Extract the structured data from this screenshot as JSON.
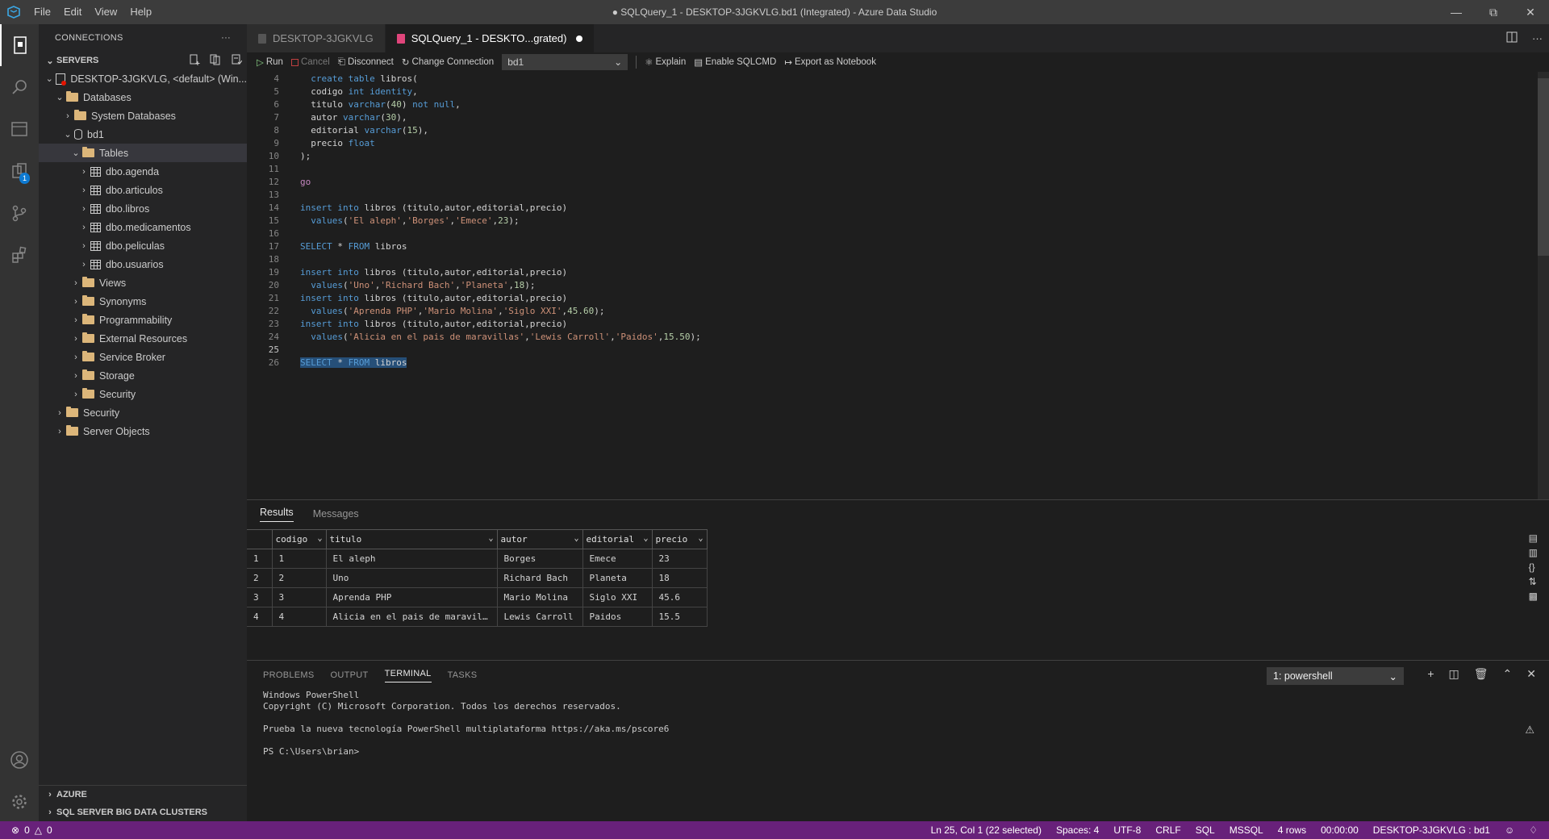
{
  "window": {
    "title": "● SQLQuery_1 - DESKTOP-3JGKVLG.bd1 (Integrated) - Azure Data Studio",
    "menu": [
      "File",
      "Edit",
      "View",
      "Help"
    ]
  },
  "activity": {
    "extensions_badge": "1"
  },
  "sidebar": {
    "header": "CONNECTIONS",
    "header_more": "···",
    "servers_label": "SERVERS",
    "tree": [
      {
        "label": "DESKTOP-3JGKVLG, <default> (Win..."
      },
      {
        "label": "Databases"
      },
      {
        "label": "System Databases"
      },
      {
        "label": "bd1"
      },
      {
        "label": "Tables"
      },
      {
        "label": "dbo.agenda"
      },
      {
        "label": "dbo.articulos"
      },
      {
        "label": "dbo.libros"
      },
      {
        "label": "dbo.medicamentos"
      },
      {
        "label": "dbo.peliculas"
      },
      {
        "label": "dbo.usuarios"
      },
      {
        "label": "Views"
      },
      {
        "label": "Synonyms"
      },
      {
        "label": "Programmability"
      },
      {
        "label": "External Resources"
      },
      {
        "label": "Service Broker"
      },
      {
        "label": "Storage"
      },
      {
        "label": "Security"
      },
      {
        "label": "Security"
      },
      {
        "label": "Server Objects"
      }
    ],
    "azure_label": "AZURE",
    "bigdata_label": "SQL SERVER BIG DATA CLUSTERS"
  },
  "tabs": [
    {
      "label": "DESKTOP-3JGKVLG"
    },
    {
      "label": "SQLQuery_1 - DESKTO...grated)"
    }
  ],
  "toolbar": {
    "run": "Run",
    "cancel": "Cancel",
    "disconnect": "Disconnect",
    "change_connection": "Change Connection",
    "database": "bd1",
    "explain": "Explain",
    "sqlcmd": "Enable SQLCMD",
    "export": "Export as Notebook"
  },
  "results": {
    "tabs": [
      "Results",
      "Messages"
    ],
    "columns": [
      "codigo",
      "titulo",
      "autor",
      "editorial",
      "precio"
    ],
    "rows": [
      [
        "1",
        "1",
        "El aleph",
        "Borges",
        "Emece",
        "23"
      ],
      [
        "2",
        "2",
        "Uno",
        "Richard Bach",
        "Planeta",
        "18"
      ],
      [
        "3",
        "3",
        "Aprenda PHP",
        "Mario Molina",
        "Siglo XXI",
        "45.6"
      ],
      [
        "4",
        "4",
        "Alicia en el pais de maravil...",
        "Lewis Carroll",
        "Paidos",
        "15.5"
      ]
    ]
  },
  "panel": {
    "tabs": [
      "PROBLEMS",
      "OUTPUT",
      "TERMINAL",
      "TASKS"
    ],
    "terminal_select": "1: powershell",
    "terminal_lines": [
      "Windows PowerShell",
      "Copyright (C) Microsoft Corporation. Todos los derechos reservados.",
      "",
      "Prueba la nueva tecnología PowerShell multiplataforma https://aka.ms/pscore6",
      "",
      "PS C:\\Users\\brian>"
    ]
  },
  "status": {
    "errors": "0",
    "warnings": "0",
    "position": "Ln 25, Col 1 (22 selected)",
    "spaces": "Spaces: 4",
    "encoding": "UTF-8",
    "eol": "CRLF",
    "language": "SQL",
    "provider": "MSSQL",
    "rows": "4 rows",
    "time": "00:00:00",
    "connection": "DESKTOP-3JGKVLG : bd1"
  },
  "colors": {
    "statusbar": "#68217a",
    "accent": "#0e7ad2",
    "keyword": "#c586c0",
    "type": "#569cd6",
    "string": "#ce9178"
  }
}
